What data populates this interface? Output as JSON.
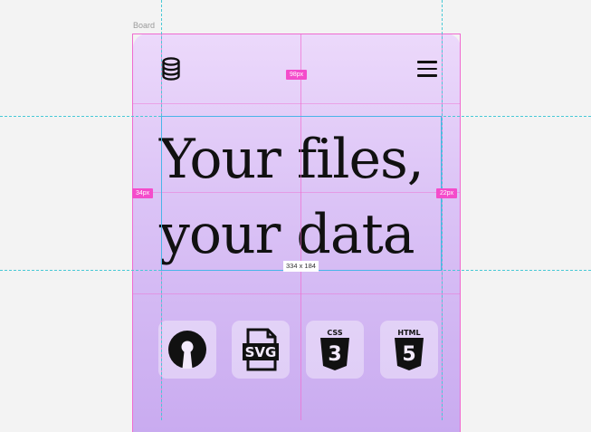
{
  "canvas": {
    "board_label": "Board"
  },
  "header": {
    "logo_icon": "database-icon",
    "menu_icon": "hamburger-menu-icon"
  },
  "hero": {
    "line1": "Your files,",
    "line2": "your data"
  },
  "tech_icons": [
    {
      "name": "open-source-icon"
    },
    {
      "name": "svg-file-icon",
      "text": "SVG"
    },
    {
      "name": "css3-icon",
      "text": "CSS",
      "number": "3"
    },
    {
      "name": "html5-icon",
      "text": "HTML",
      "number": "5"
    }
  ],
  "measurements": {
    "top_spacing": "98px",
    "left_spacing": "34px",
    "right_spacing": "22px",
    "selection_size": "334 x 184"
  },
  "colors": {
    "board_gradient_top": "#ecd9fb",
    "board_gradient_bottom": "#c9abf0",
    "guide": "#48c9d6",
    "badge": "#f44ccb",
    "selection": "#49b5e8"
  }
}
